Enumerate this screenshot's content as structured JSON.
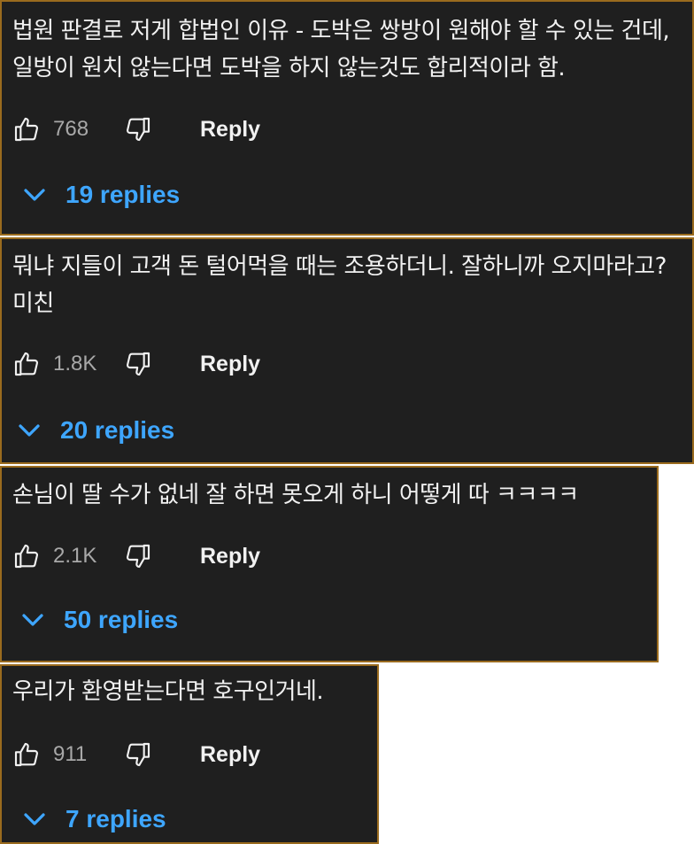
{
  "comments": [
    {
      "text": "법원 판결로 저게 합법인 이유 - 도박은 쌍방이 원해야 할 수 있는 건데, 일방이 원치 않는다면 도박을 하지 않는것도 합리적이라 함.",
      "likes": "768",
      "reply_label": "Reply",
      "replies_label": "19 replies"
    },
    {
      "text": "뭐냐 지들이 고객 돈 털어먹을 때는 조용하더니. 잘하니까 오지마라고? 미친",
      "likes": "1.8K",
      "reply_label": "Reply",
      "replies_label": "20 replies"
    },
    {
      "text": "손님이 딸 수가 없네 잘 하면 못오게 하니 어떻게 따 ㅋㅋㅋㅋ",
      "likes": "2.1K",
      "reply_label": "Reply",
      "replies_label": "50 replies"
    },
    {
      "text": "우리가 환영받는다면 호구인거네.",
      "likes": "911",
      "reply_label": "Reply",
      "replies_label": "7 replies"
    }
  ],
  "colors": {
    "card_bg": "#1f1f1f",
    "border": "#9a6b1e",
    "text": "#f1f1f1",
    "count": "#a8a8a8",
    "replies_link": "#3ea6ff"
  },
  "icons": [
    "thumbs-up-icon",
    "thumbs-down-icon",
    "chevron-down-icon"
  ]
}
